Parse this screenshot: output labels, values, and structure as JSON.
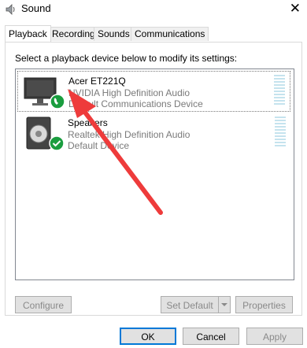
{
  "window": {
    "title": "Sound",
    "close_glyph": "✕"
  },
  "tabs": [
    {
      "label": "Playback",
      "active": true
    },
    {
      "label": "Recording",
      "active": false
    },
    {
      "label": "Sounds",
      "active": false
    },
    {
      "label": "Communications",
      "active": false
    }
  ],
  "instruction": "Select a playback device below to modify its settings:",
  "devices": [
    {
      "name": "Acer ET221Q",
      "driver": "NVIDIA High Definition Audio",
      "status": "Default Communications Device",
      "icon": "monitor-icon",
      "badge_icon": "phone-badge-icon",
      "selected": true
    },
    {
      "name": "Speakers",
      "driver": "Realtek High Definition Audio",
      "status": "Default Device",
      "icon": "speaker-icon",
      "badge_icon": "checkmark-badge-icon",
      "selected": false
    }
  ],
  "buttons": {
    "configure": "Configure",
    "set_default": "Set Default",
    "properties": "Properties",
    "ok": "OK",
    "cancel": "Cancel",
    "apply": "Apply"
  },
  "colors": {
    "badge_green": "#1a9d3f",
    "annotation_arrow": "#ee3b3b",
    "focus_blue": "#0078d7"
  }
}
